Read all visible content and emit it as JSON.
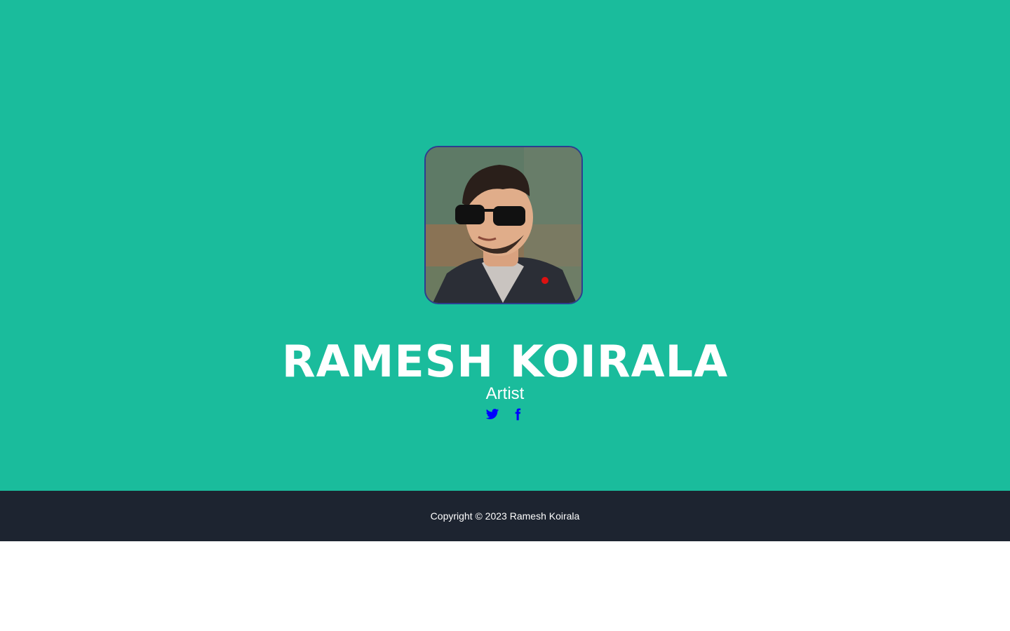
{
  "profile": {
    "name": "RAMESH KOIRALA",
    "role": "Artist",
    "avatar_alt": "profile-photo"
  },
  "social": [
    {
      "name": "twitter",
      "icon": "twitter-icon"
    },
    {
      "name": "facebook",
      "icon": "facebook-icon"
    }
  ],
  "footer": {
    "copyright": "Copyright © 2023 Ramesh Koirala"
  },
  "colors": {
    "hero_bg": "#1abc9c",
    "footer_bg": "#1d2430",
    "link": "#0000ff",
    "text": "#ffffff"
  }
}
